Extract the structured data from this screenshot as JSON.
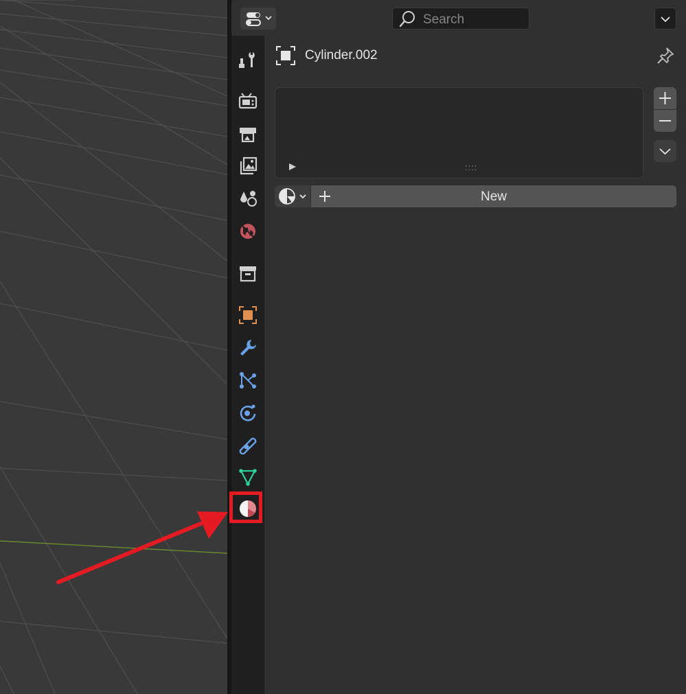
{
  "header": {
    "editor_type_icon": "editor-type-properties-icon",
    "search_placeholder": "Search"
  },
  "tabs": [
    {
      "id": "tool",
      "icon": "tool-icon"
    },
    {
      "id": "render",
      "icon": "render-icon"
    },
    {
      "id": "output",
      "icon": "output-icon"
    },
    {
      "id": "view-layer",
      "icon": "view-layer-icon"
    },
    {
      "id": "scene",
      "icon": "scene-icon"
    },
    {
      "id": "world",
      "icon": "world-icon"
    },
    {
      "id": "collection",
      "icon": "collection-icon"
    },
    {
      "id": "object",
      "icon": "object-icon"
    },
    {
      "id": "modifiers",
      "icon": "wrench-icon"
    },
    {
      "id": "particles",
      "icon": "particles-icon"
    },
    {
      "id": "physics",
      "icon": "physics-icon"
    },
    {
      "id": "constraints",
      "icon": "constraints-icon"
    },
    {
      "id": "data",
      "icon": "mesh-data-icon"
    },
    {
      "id": "material",
      "icon": "material-icon",
      "highlighted": true
    }
  ],
  "object": {
    "name": "Cylinder.002"
  },
  "material": {
    "new_label": "New",
    "expand_glyph": "►",
    "grip_glyph": "::::"
  },
  "annotation": {
    "color": "#e51b23"
  }
}
